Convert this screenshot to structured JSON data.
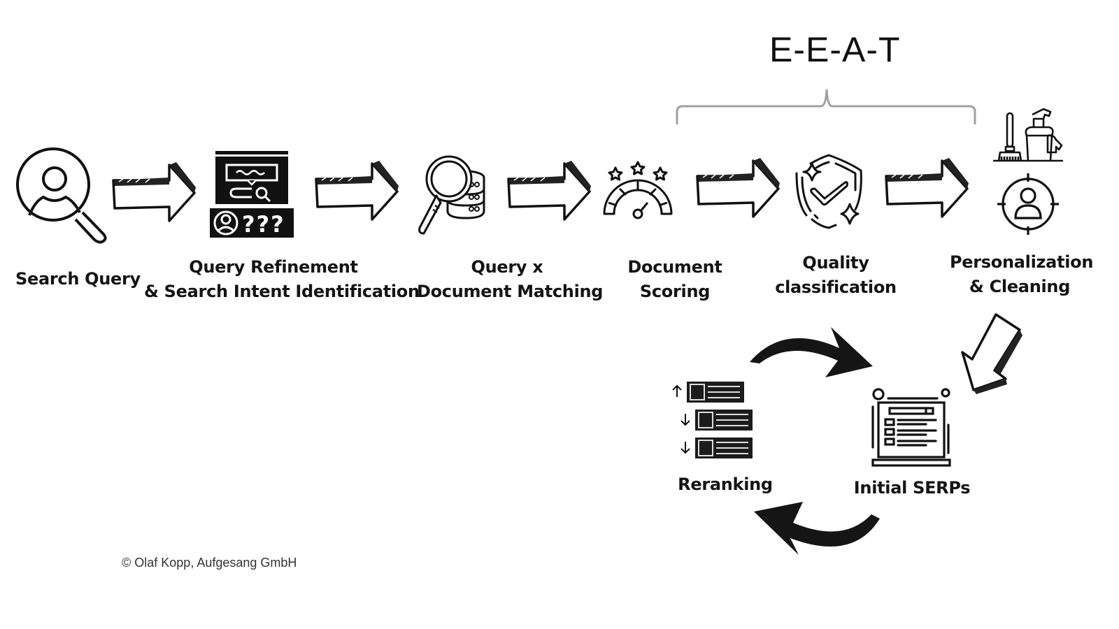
{
  "title": "E-E-A-T",
  "steps": [
    {
      "label_lines": [
        "Search Query"
      ],
      "icon": "user-search-icon"
    },
    {
      "label_lines": [
        "Query Refinement",
        "& Search Intent Identification"
      ],
      "icon": "query-refinement-icon"
    },
    {
      "label_lines": [
        "Query x",
        "Document Matching"
      ],
      "icon": "database-search-icon"
    },
    {
      "label_lines": [
        "Document",
        "Scoring"
      ],
      "icon": "score-gauge-icon"
    },
    {
      "label_lines": [
        "Quality",
        "classification"
      ],
      "icon": "quality-shield-icon"
    },
    {
      "label_lines": [
        "Personalization",
        "& Cleaning"
      ],
      "icon": "cleaning-personalization-icon"
    }
  ],
  "cycle": {
    "reranking_label": "Reranking",
    "serps_label": "Initial SERPs",
    "rank_arrows": [
      "↑",
      "↓",
      "↓"
    ]
  },
  "eeat_bracket_spans": [
    "Document Scoring",
    "Quality classification",
    "Personalization & Cleaning"
  ],
  "copyright": "© Olaf Kopp, Aufgesang GmbH"
}
